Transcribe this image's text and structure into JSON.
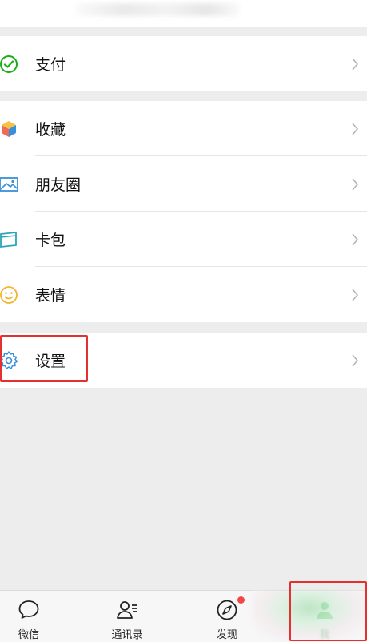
{
  "menu": {
    "pay": {
      "label": "支付",
      "icon": "wallet-check-icon"
    },
    "collections": {
      "label": "收藏",
      "icon": "cube-icon"
    },
    "moments": {
      "label": "朋友圈",
      "icon": "picture-icon"
    },
    "cards": {
      "label": "卡包",
      "icon": "card-wallet-icon"
    },
    "stickers": {
      "label": "表情",
      "icon": "smiley-icon"
    },
    "settings": {
      "label": "设置",
      "icon": "gear-icon"
    }
  },
  "tabbar": {
    "chats": {
      "label": "微信",
      "icon": "chat-bubble-icon"
    },
    "contacts": {
      "label": "通讯录",
      "icon": "contacts-icon"
    },
    "discover": {
      "label": "发现",
      "icon": "compass-icon",
      "badge": "red-dot"
    },
    "me": {
      "label": "我",
      "icon": "person-icon"
    }
  },
  "colors": {
    "highlight": "#e53030",
    "wechat_green": "#1aad19",
    "badge_red": "#f04848"
  }
}
